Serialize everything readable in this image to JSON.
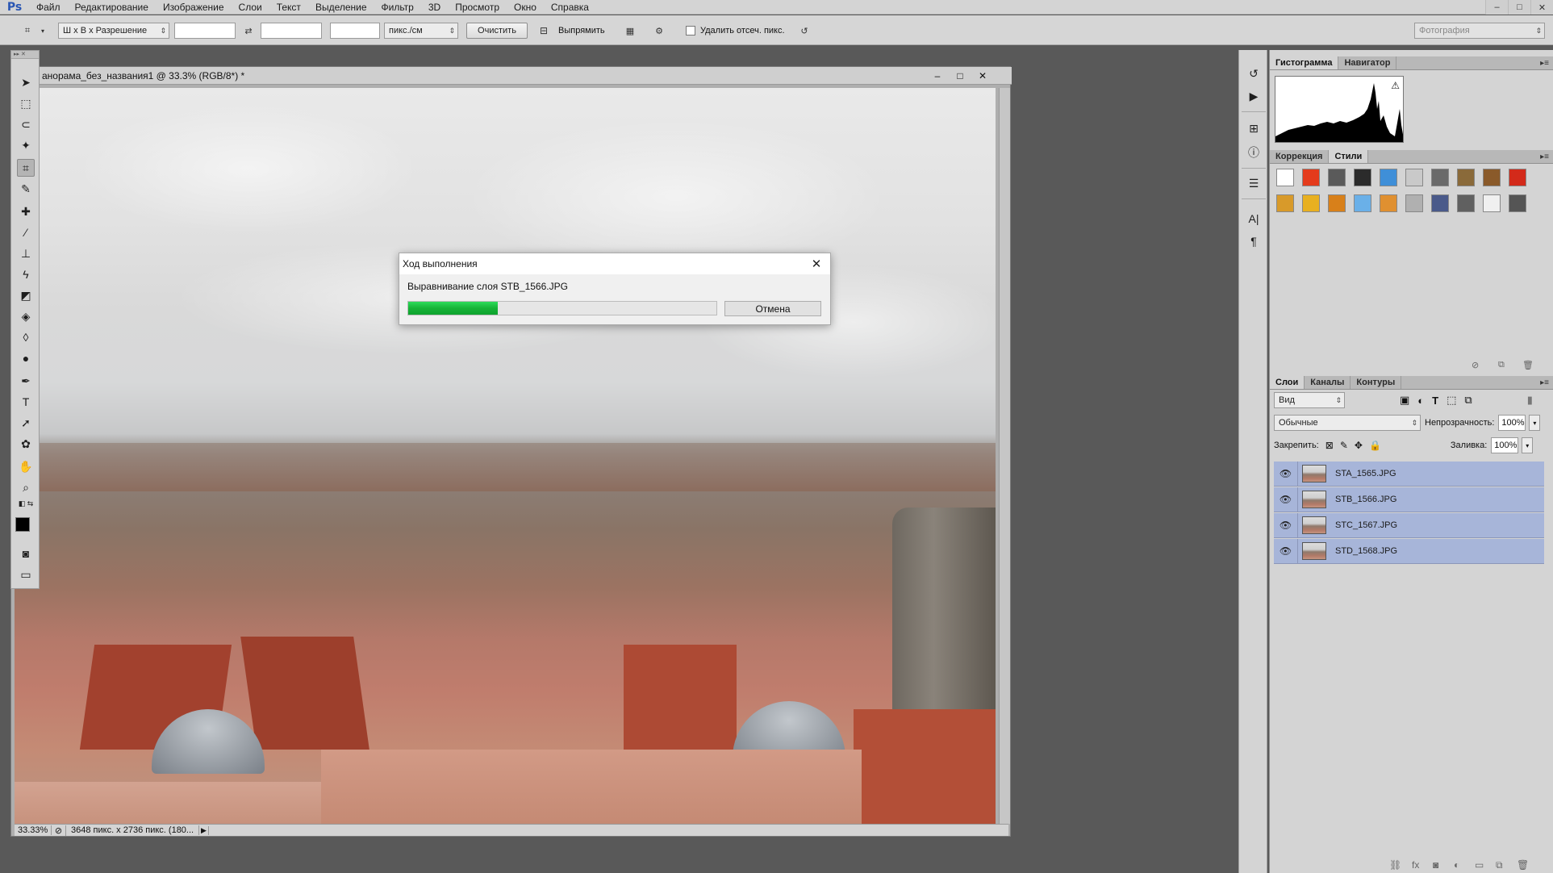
{
  "app": {
    "logo": "Ps"
  },
  "menu": [
    "Файл",
    "Редактирование",
    "Изображение",
    "Слои",
    "Текст",
    "Выделение",
    "Фильтр",
    "3D",
    "Просмотр",
    "Окно",
    "Справка"
  ],
  "window_controls": {
    "minimize": "–",
    "maximize": "□",
    "close": "✕"
  },
  "options": {
    "ratio_select": "Ш x В x Разрешение",
    "units_select": "пикс./см",
    "clear_button": "Очистить",
    "straighten_button": "Выпрямить",
    "delete_cropped_label": "Удалить отсеч. пикс.",
    "workspace_select": "Фотография"
  },
  "document": {
    "title": "анорама_без_названия1 @ 33.3% (RGB/8*) *",
    "zoom": "33.33%",
    "info": "3648 пикс. x 2736 пикс. (180..."
  },
  "panels": {
    "histogram_tabs": [
      "Гистограмма",
      "Навигатор"
    ],
    "styles_tabs": [
      "Коррекция",
      "Стили"
    ],
    "layers_tabs": [
      "Слои",
      "Каналы",
      "Контуры"
    ]
  },
  "layers": {
    "filter_select": "Вид",
    "blend_select": "Обычные",
    "opacity_label": "Непрозрачность:",
    "opacity_value": "100%",
    "lock_label": "Закрепить:",
    "fill_label": "Заливка:",
    "fill_value": "100%",
    "items": [
      {
        "name": "STA_1565.JPG"
      },
      {
        "name": "STB_1566.JPG"
      },
      {
        "name": "STC_1567.JPG"
      },
      {
        "name": "STD_1568.JPG"
      }
    ]
  },
  "dialog": {
    "title": "Ход выполнения",
    "message": "Выравнивание слоя STB_1566.JPG",
    "cancel": "Отмена",
    "progress": 0.29
  },
  "colors": {
    "progress": "#16b437",
    "layer_selected": "#a7b5d9",
    "ps_blue": "#2a56b4"
  }
}
